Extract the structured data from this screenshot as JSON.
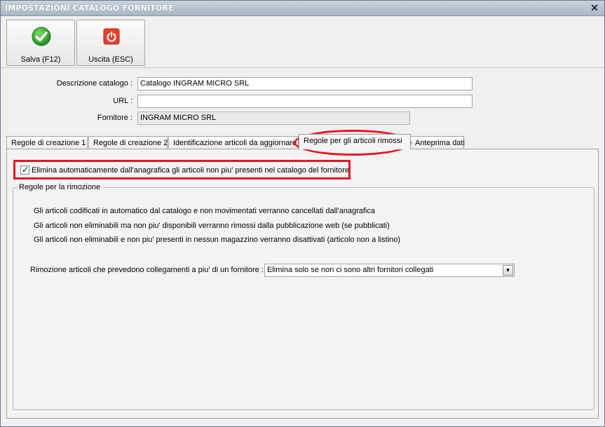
{
  "window": {
    "title": "IMPOSTAZIONI CATALOGO FORNITORE",
    "close_glyph": "✕"
  },
  "toolbar": {
    "save": {
      "label": "Salva (F12)",
      "icon": "check-icon",
      "color": "#2fa12f"
    },
    "exit": {
      "label": "Uscita (ESC)",
      "icon": "power-icon",
      "color": "#e8422c"
    }
  },
  "form": {
    "descrizione": {
      "label": "Descrizione catalogo :",
      "value": "Catalogo INGRAM MICRO SRL"
    },
    "url": {
      "label": "URL :",
      "value": ""
    },
    "fornitore": {
      "label": "Fornitore :",
      "value": "INGRAM MICRO SRL"
    }
  },
  "tabs": [
    {
      "label": "Regole di creazione 1"
    },
    {
      "label": "Regole di creazione 2"
    },
    {
      "label": "Identificazione articoli da aggiornare"
    },
    {
      "label": "Regole per gli articoli rimossi",
      "active": true
    },
    {
      "label": "Anteprima dati"
    }
  ],
  "panel": {
    "checkbox": {
      "label": "Elimina automaticamente dall'anagrafica gli articoli non piu' presenti nel catalogo del fornitore",
      "checked": true
    },
    "group": {
      "title": "Regole per la rimozione",
      "rules": [
        "Gli articoli codificati in automatico dal catalogo e non movimentati verranno cancellati dall'anagrafica",
        "Gli articoli non eliminabili ma non piu' disponibili verranno rimossi dalla pubblicazione web (se pubblicati)",
        "Gli articoli non eliminabili e non piu' presenti in nessun magazzino verranno disattivati (articolo non a listino)"
      ],
      "multi_supplier": {
        "label": "Rimozione articoli che prevedono collegamenti a piu' di un fornitore :",
        "selected": "Elimina solo se non ci sono altri fornitori collegati"
      }
    }
  },
  "colors": {
    "highlight": "#e8141e"
  }
}
